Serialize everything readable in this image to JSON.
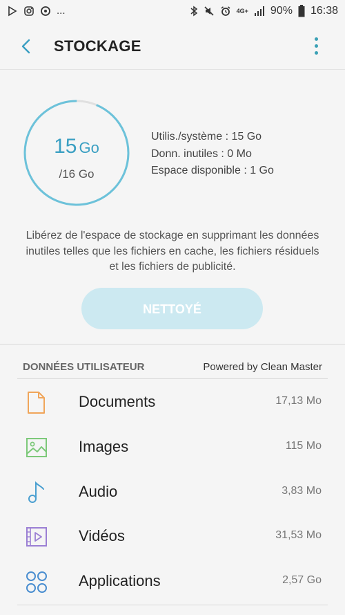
{
  "status_bar": {
    "dots": "...",
    "network": "4G+",
    "battery": "90%",
    "time": "16:38"
  },
  "header": {
    "title": "STOCKAGE"
  },
  "storage": {
    "used_value": "15",
    "used_unit": "Go",
    "total": "/16 Go",
    "used_fraction": 0.9375,
    "stats": [
      "Utilis./système : 15 Go",
      "Donn. inutiles : 0 Mo",
      "Espace disponible : 1 Go"
    ],
    "description": "Libérez de l'espace de stockage en supprimant les données inutiles telles que les fichiers en cache, les fichiers résiduels et les fichiers de publicité.",
    "clean_button": "NETTOYÉ"
  },
  "user_data": {
    "heading": "DONNÉES UTILISATEUR",
    "powered_by": "Powered by Clean Master",
    "items": [
      {
        "label": "Documents",
        "size": "17,13 Mo",
        "icon": "document-icon",
        "color": "#f0a55a"
      },
      {
        "label": "Images",
        "size": "115 Mo",
        "icon": "image-icon",
        "color": "#7dc97a"
      },
      {
        "label": "Audio",
        "size": "3,83 Mo",
        "icon": "music-note-icon",
        "color": "#4a9fd0"
      },
      {
        "label": "Vidéos",
        "size": "31,53 Mo",
        "icon": "video-icon",
        "color": "#9b7fd4"
      },
      {
        "label": "Applications",
        "size": "2,57 Go",
        "icon": "apps-grid-icon",
        "color": "#4a8ed0"
      }
    ]
  },
  "colors": {
    "accent": "#3a9fc2",
    "ring_bg": "#e0e0e0",
    "button_bg": "#cce9f1"
  }
}
